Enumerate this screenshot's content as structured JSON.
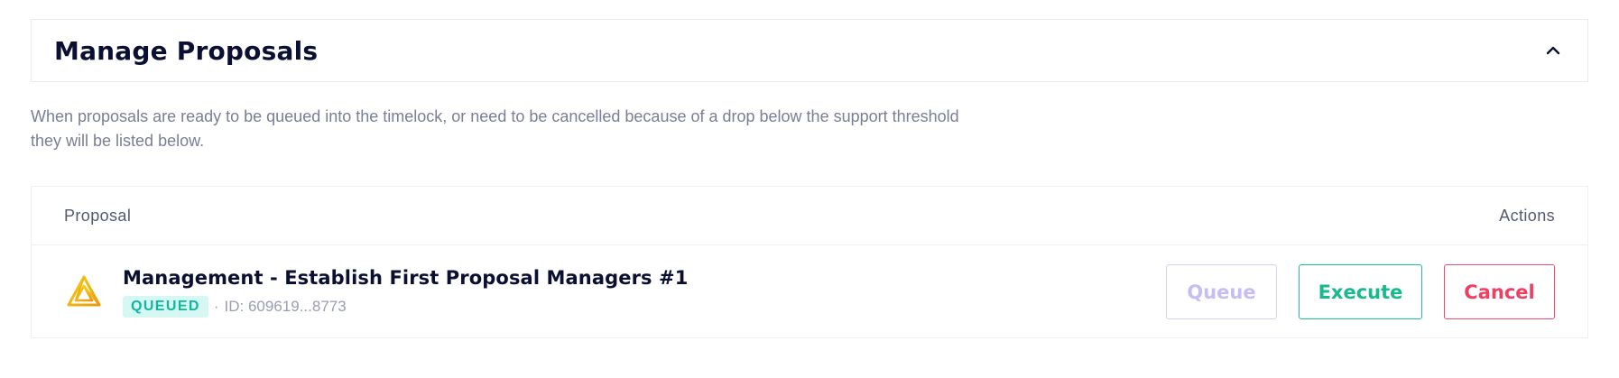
{
  "header": {
    "title": "Manage Proposals",
    "collapse_icon": "chevron-up-icon"
  },
  "description": "When proposals are ready to be queued into the timelock, or need to be cancelled because of a drop below the support threshold they will be listed below.",
  "table": {
    "columns": {
      "proposal": "Proposal",
      "actions": "Actions"
    },
    "rows": [
      {
        "icon": "triangle-logo-icon",
        "title": "Management - Establish First Proposal Managers #1",
        "status": "QUEUED",
        "separator": "·",
        "id_text": "ID: 609619...8773",
        "actions": {
          "queue": "Queue",
          "execute": "Execute",
          "cancel": "Cancel"
        }
      }
    ]
  },
  "colors": {
    "title": "#0b1033",
    "queued_badge_bg": "#d6f8f3",
    "queued_badge_text": "#13b59e",
    "queue_disabled": "#c6bdf4",
    "execute": "#17b98d",
    "cancel": "#ef3f63",
    "logo_gold": "#f2b705"
  }
}
